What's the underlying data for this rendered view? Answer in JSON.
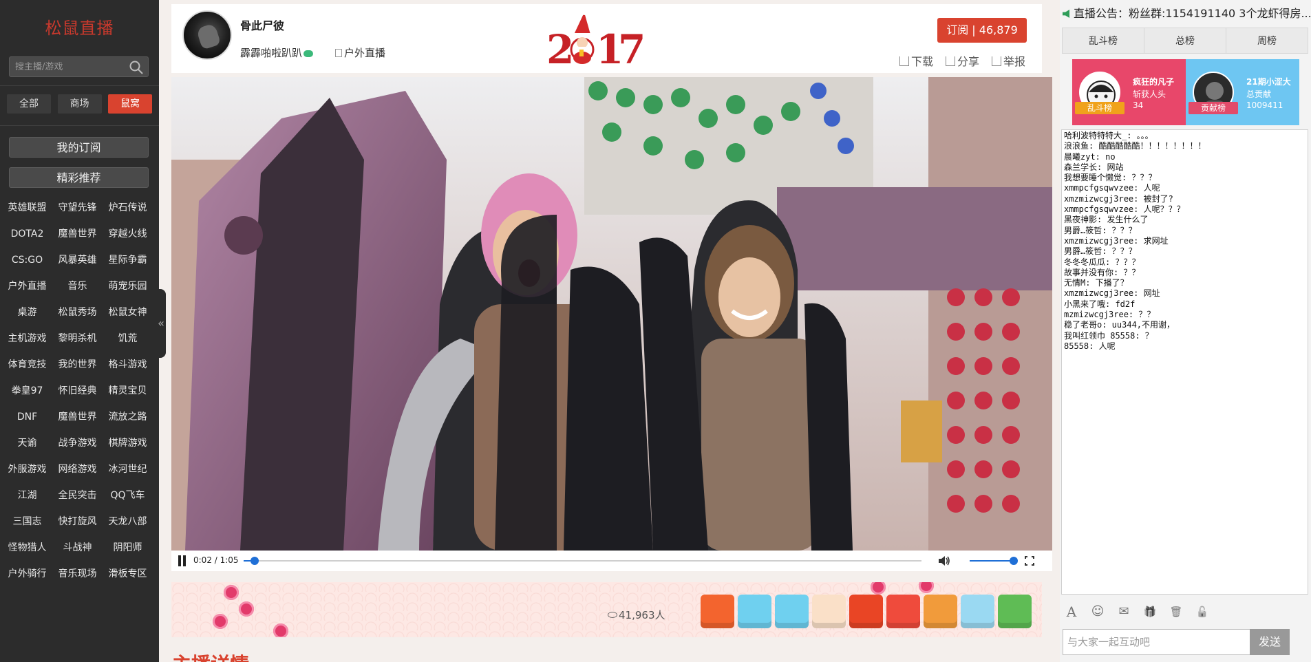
{
  "sidebar": {
    "brand": "松鼠直播",
    "search_placeholder": "搜主播/游戏",
    "filters": [
      "全部",
      "商场",
      "鼠窝"
    ],
    "my_subscriptions": "我的订阅",
    "featured": "精彩推荐",
    "categories": [
      "英雄联盟",
      "守望先锋",
      "炉石传说",
      "DOTA2",
      "魔兽世界",
      "穿越火线",
      "CS:GO",
      "风暴英雄",
      "星际争霸",
      "户外直播",
      "音乐",
      "萌宠乐园",
      "桌游",
      "松鼠秀场",
      "松鼠女神",
      "主机游戏",
      "黎明杀机",
      "饥荒",
      "体育竞技",
      "我的世界",
      "格斗游戏",
      "拳皇97",
      "怀旧经典",
      "精灵宝贝",
      "DNF",
      "魔兽世界",
      "流放之路",
      "天谕",
      "战争游戏",
      "棋牌游戏",
      "外服游戏",
      "网络游戏",
      "冰河世纪",
      "江湖",
      "全民突击",
      "QQ飞车",
      "三国志",
      "快打旋风",
      "天龙八部",
      "怪物猎人",
      "斗战神",
      "阴阳师",
      "户外骑行",
      "音乐现场",
      "滑板专区"
    ],
    "collapse_icon": "«"
  },
  "header": {
    "streamer_name": "骨此尸彼",
    "subtitle": "霹霹啪啦趴趴",
    "category": "户外直播",
    "subscribe_label": "订阅 | 46,879",
    "actions": [
      "下载",
      "分享",
      "举报"
    ]
  },
  "player": {
    "time": "0:02 / 1:05",
    "progress": 0.016,
    "volume": 1.0
  },
  "giftbar": {
    "viewers": "41,963人",
    "gifts": [
      "orange-pouch-gift",
      "polar-bear-gift",
      "snowflake-gift",
      "gingerbread-gift",
      "golden-bell-gift",
      "lobster-gift",
      "taiyaki-fish-gift",
      "rice-ball-gift",
      "sushi-roll-gift"
    ],
    "gift_colors": [
      "#f3642e",
      "#6fd0ef",
      "#6fd0ef",
      "#fae0c8",
      "#e94525",
      "#ef4b3c",
      "#f19b3b",
      "#9ad9f2",
      "#5fbc55"
    ]
  },
  "details_title": "主播详情",
  "right": {
    "announcement": "直播公告：粉丝群:1154191140 3个龙虾得房...",
    "rank_tabs": [
      "乱斗榜",
      "总榜",
      "周榜"
    ],
    "card_left": {
      "badge": "乱斗榜",
      "name": "疯狂的凡子",
      "line2": "斩获人头",
      "line3": "34"
    },
    "card_right": {
      "badge": "贡献榜",
      "name": "21期小涩大",
      "line2": "总贡献",
      "line3": "1009411"
    },
    "chat": [
      "哈利波特特特大_: 。。。",
      "浪浪鱼: 酷酷酷酷酷！！！！！！！！",
      "晨曦zyt: no",
      "森兰学长: 网站",
      "我想要睡个懒觉: ？？？",
      "xmmpcfgsqwvzee: 人呢",
      "xmzmizwcgj3ree: 被封了?",
      "xmmpcfgsqwvzee: 人呢？？？",
      "黑夜神影: 发生什么了",
      "男爵…筱哲: ？？？",
      "xmzmizwcgj3ree: 求网址",
      "男爵…筱哲: ？？？",
      "冬冬冬瓜瓜: ？？？",
      "故事并没有你: ？？",
      "无情M: 下播了？",
      "xmzmizwcgj3ree: 网址",
      "小黑来了哦: fd2f",
      "mzmizwcgj3ree: ？？",
      "稳了老哥o: uu344,不用谢，",
      "我叫红领巾   85558: ？",
      "85558: 人呢"
    ],
    "tools": [
      "A",
      "☺",
      "✉",
      "🎁",
      "🗑",
      "🔓"
    ],
    "chat_placeholder": "与大家一起互动吧",
    "send_label": "发送"
  },
  "colors": {
    "accent_red": "#d9432f",
    "sidebar_bg": "#2c2c2c",
    "progress_blue": "#1f6fd6"
  }
}
